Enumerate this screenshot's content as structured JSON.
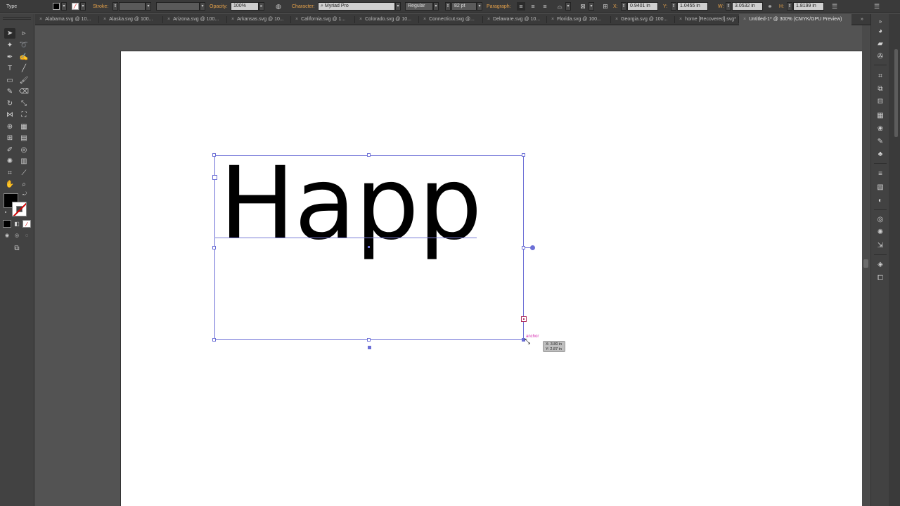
{
  "control_bar": {
    "mode_label": "Type",
    "stroke_label": "Stroke:",
    "opacity_label": "Opacity:",
    "opacity_value": "100%",
    "character_label": "Character:",
    "font_family": "Myriad Pro",
    "font_style": "Regular",
    "font_size": "82 pt",
    "paragraph_label": "Paragraph:",
    "x_label": "X:",
    "x_value": "0.9401 in",
    "y_label": "Y:",
    "y_value": "1.0455 in",
    "w_label": "W:",
    "w_value": "3.0532 in",
    "h_label": "H:",
    "h_value": "1.8199 in"
  },
  "tabs": [
    {
      "label": "Alabama.svg @ 10..."
    },
    {
      "label": "Alaska.svg @ 100..."
    },
    {
      "label": "Arizona.svg @ 100..."
    },
    {
      "label": "Arkansas.svg @ 10..."
    },
    {
      "label": "California.svg @ 1..."
    },
    {
      "label": "Colorado.svg @ 10..."
    },
    {
      "label": "Connecticut.svg @..."
    },
    {
      "label": "Delaware.svg @ 10..."
    },
    {
      "label": "Florida.svg @ 100..."
    },
    {
      "label": "Georgia.svg @ 100..."
    },
    {
      "label": "home [Recovered].svg*"
    },
    {
      "label": "Untitled-1* @ 300% (CMYK/GPU Preview)"
    }
  ],
  "artboard": {
    "text": "Happ",
    "smart_guide_label": "anchor",
    "coord_x": "X: 3.80 in",
    "coord_y": "Y: 2.87 in"
  },
  "icons": {
    "close": "×",
    "tab_overflow": "»"
  },
  "colors": {
    "accent": "#6c6fd6",
    "ui_label": "#e8a34a",
    "smart_guide": "#d62fb0"
  }
}
